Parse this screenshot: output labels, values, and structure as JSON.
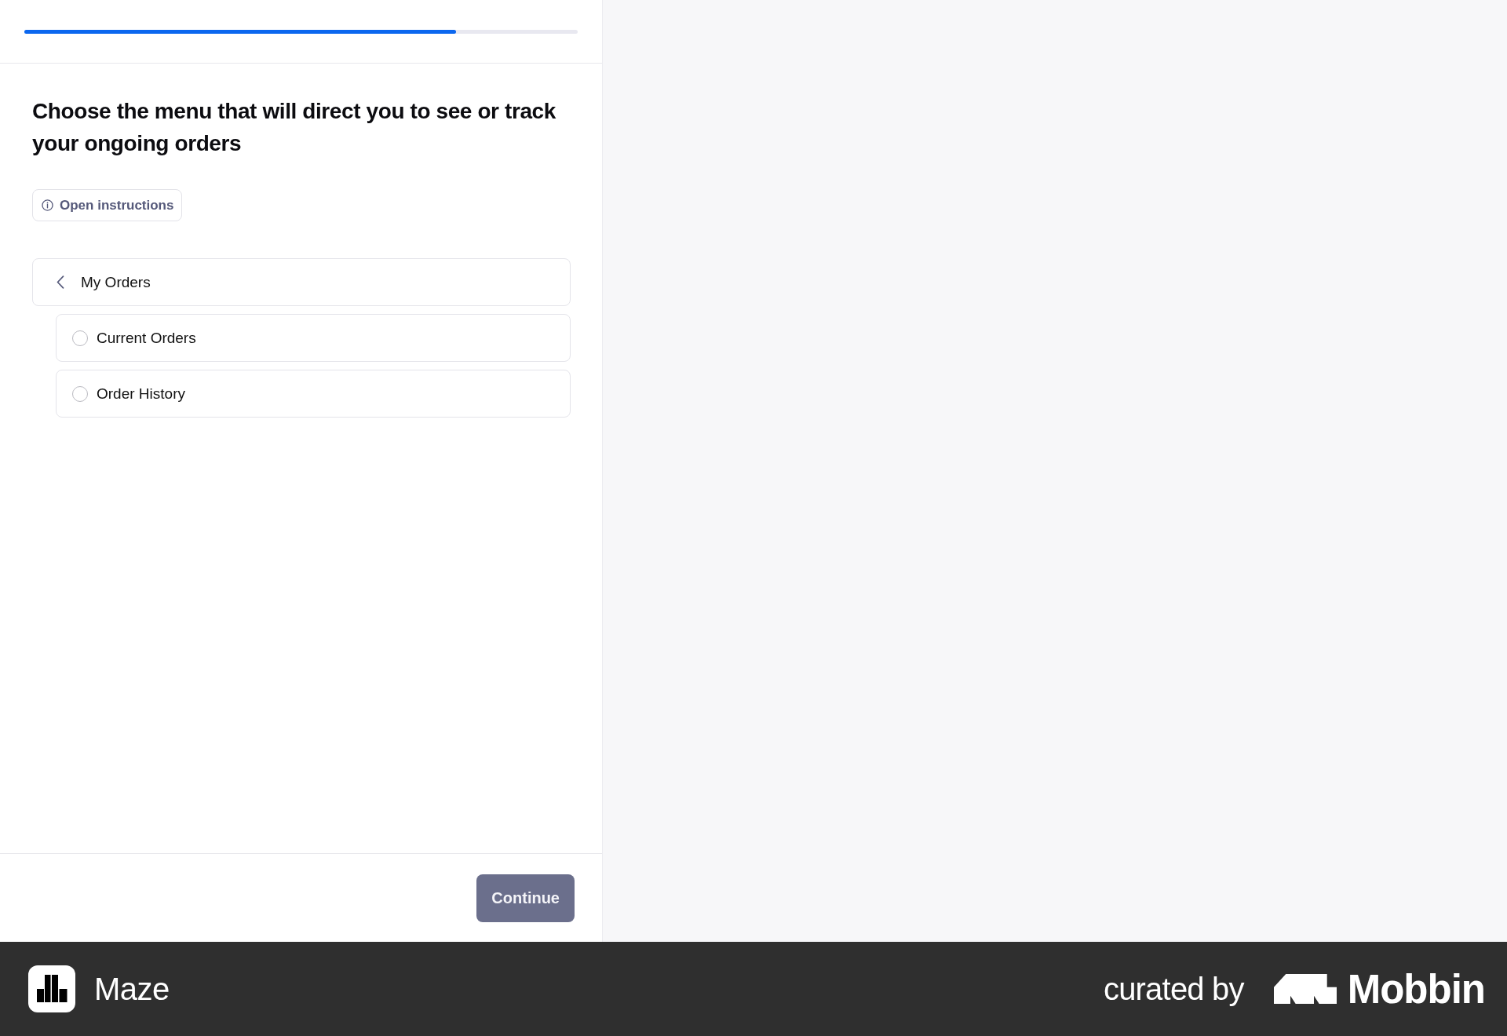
{
  "progress": {
    "level": 0.78
  },
  "question": {
    "title": "Choose the menu that will direct you to see or track your ongoing orders",
    "instructions_button": "Open instructions"
  },
  "menu": {
    "parent": {
      "label": "My Orders"
    },
    "options": [
      {
        "label": "Current Orders",
        "selected": false
      },
      {
        "label": "Order History",
        "selected": false
      }
    ]
  },
  "footer": {
    "continue_button": {
      "label": "Continue",
      "disabled": true
    }
  },
  "branding": {
    "app_name": "Maze",
    "curated_by": "curated by",
    "brand": "Mobbin"
  }
}
